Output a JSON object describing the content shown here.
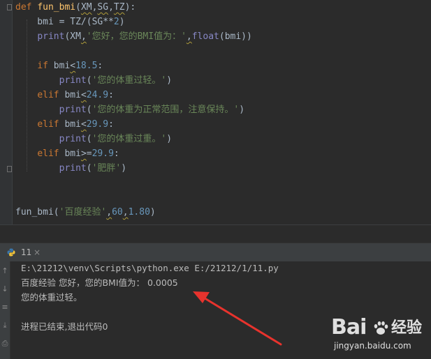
{
  "editor": {
    "lines": [
      [
        [
          "kw",
          "def "
        ],
        [
          "fn",
          "fun_bmi"
        ],
        [
          "plain",
          "("
        ],
        [
          "sq",
          "XM"
        ],
        [
          "plain",
          ","
        ],
        [
          "sq",
          "SG"
        ],
        [
          "plain",
          ","
        ],
        [
          "sq",
          "TZ"
        ],
        [
          "plain",
          "):"
        ]
      ],
      [
        [
          "plain",
          "    bmi = TZ/(SG**"
        ],
        [
          "num",
          "2"
        ],
        [
          "plain",
          ")"
        ]
      ],
      [
        [
          "plain",
          "    "
        ],
        [
          "bi",
          "print"
        ],
        [
          "plain",
          "(XM"
        ],
        [
          "sq",
          ","
        ],
        [
          "str",
          "'您好，您的BMI值为：'"
        ],
        [
          "sq",
          ","
        ],
        [
          "bi",
          "float"
        ],
        [
          "plain",
          "(bmi))"
        ]
      ],
      [],
      [
        [
          "plain",
          "    "
        ],
        [
          "kw",
          "if "
        ],
        [
          "plain",
          "bmi"
        ],
        [
          "sq",
          "<"
        ],
        [
          "num",
          "18.5"
        ],
        [
          "plain",
          ":"
        ]
      ],
      [
        [
          "plain",
          "        "
        ],
        [
          "bi",
          "print"
        ],
        [
          "plain",
          "("
        ],
        [
          "str",
          "'您的体重过轻。'"
        ],
        [
          "plain",
          ")"
        ]
      ],
      [
        [
          "plain",
          "    "
        ],
        [
          "kw",
          "elif "
        ],
        [
          "plain",
          "bmi"
        ],
        [
          "sq",
          "<"
        ],
        [
          "num",
          "24.9"
        ],
        [
          "plain",
          ":"
        ]
      ],
      [
        [
          "plain",
          "        "
        ],
        [
          "bi",
          "print"
        ],
        [
          "plain",
          "("
        ],
        [
          "str",
          "'您的体重为正常范围，注意保持。'"
        ],
        [
          "plain",
          ")"
        ]
      ],
      [
        [
          "plain",
          "    "
        ],
        [
          "kw",
          "elif "
        ],
        [
          "plain",
          "bmi"
        ],
        [
          "sq",
          "<"
        ],
        [
          "num",
          "29.9"
        ],
        [
          "plain",
          ":"
        ]
      ],
      [
        [
          "plain",
          "        "
        ],
        [
          "bi",
          "print"
        ],
        [
          "plain",
          "("
        ],
        [
          "str",
          "'您的体重过重。'"
        ],
        [
          "plain",
          ")"
        ]
      ],
      [
        [
          "plain",
          "    "
        ],
        [
          "kw",
          "elif "
        ],
        [
          "plain",
          "bmi"
        ],
        [
          "sq",
          ">"
        ],
        [
          "plain",
          "="
        ],
        [
          "num",
          "29.9"
        ],
        [
          "plain",
          ":"
        ]
      ],
      [
        [
          "plain",
          "        "
        ],
        [
          "bi",
          "print"
        ],
        [
          "plain",
          "("
        ],
        [
          "str",
          "'肥胖'"
        ],
        [
          "plain",
          ")"
        ]
      ],
      [],
      [],
      [
        [
          "plain",
          "fun_bmi("
        ],
        [
          "str",
          "'百度经验'"
        ],
        [
          "sq",
          ","
        ],
        [
          "num",
          "60"
        ],
        [
          "sq",
          ","
        ],
        [
          "num",
          "1.80"
        ],
        [
          "plain",
          ")"
        ]
      ]
    ]
  },
  "run_tab": {
    "label": "11",
    "close": "×"
  },
  "side_tools": [
    "↑",
    "↓",
    "≡",
    "⤓",
    "⎙"
  ],
  "console": {
    "command": "E:\\21212\\venv\\Scripts\\python.exe E:/21212/1/11.py",
    "output_1": "百度经验 您好，您的BMI值为： 0.0005",
    "output_2": "您的体重过轻。",
    "exit_msg": "进程已结束,退出代码0"
  },
  "watermark": {
    "brand_left": "Bai",
    "brand_right": "经验",
    "url": "jingyan.baidu.com"
  },
  "colors": {
    "keyword": "#cc7832",
    "function": "#ffc66d",
    "number": "#6897bb",
    "string": "#6a8759",
    "builtin": "#8888c6",
    "arrow": "#e8332d"
  }
}
